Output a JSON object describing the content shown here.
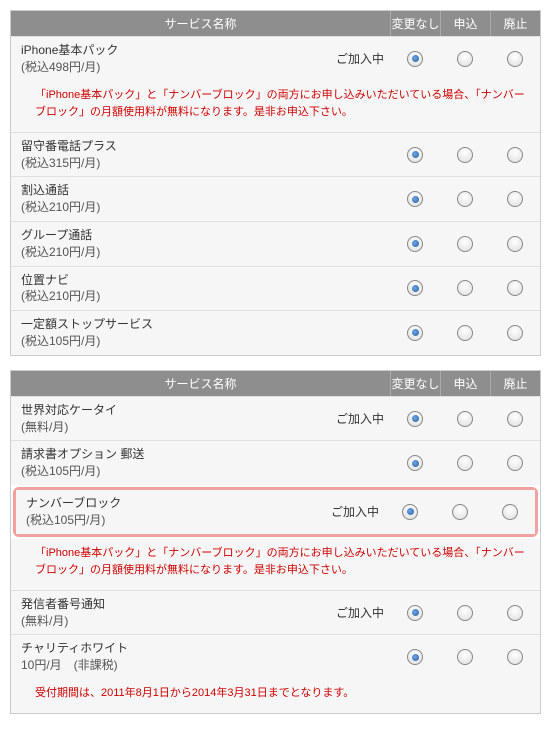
{
  "headers": {
    "service_name": "サービス名称",
    "no_change": "変更なし",
    "apply": "申込",
    "cancel": "廃止"
  },
  "status_label": "ご加入中",
  "section1": {
    "items": [
      {
        "name": "iPhone基本パック",
        "price": "(税込498円/月)",
        "status": true,
        "selected": 0
      },
      {
        "name": "留守番電話プラス",
        "price": "(税込315円/月)",
        "status": false,
        "selected": 0
      },
      {
        "name": "割込通話",
        "price": "(税込210円/月)",
        "status": false,
        "selected": 0
      },
      {
        "name": "グループ通話",
        "price": "(税込210円/月)",
        "status": false,
        "selected": 0
      },
      {
        "name": "位置ナビ",
        "price": "(税込210円/月)",
        "status": false,
        "selected": 0
      },
      {
        "name": "一定額ストップサービス",
        "price": "(税込105円/月)",
        "status": false,
        "selected": 0
      }
    ],
    "notice": "「iPhone基本パック」と「ナンバーブロック」の両方にお申し込みいただいている場合、「ナンバーブロック」の月額使用料が無料になります。是非お申込下さい。"
  },
  "section2": {
    "items": [
      {
        "name": "世界対応ケータイ",
        "price": "(無料/月)",
        "status": true,
        "selected": 0,
        "highlight": false
      },
      {
        "name": "請求書オプション 郵送",
        "price": "(税込105円/月)",
        "status": false,
        "selected": 0,
        "highlight": false
      },
      {
        "name": "ナンバーブロック",
        "price": "(税込105円/月)",
        "status": true,
        "selected": 0,
        "highlight": true
      },
      {
        "name": "発信者番号通知",
        "price": "(無料/月)",
        "status": true,
        "selected": 0,
        "highlight": false
      },
      {
        "name": "チャリティホワイト",
        "price": "10円/月　(非課税)",
        "status": false,
        "selected": 0,
        "highlight": false
      }
    ],
    "notice1": "「iPhone基本パック」と「ナンバーブロック」の両方にお申し込みいただいている場合、「ナンバーブロック」の月額使用料が無料になります。是非お申込下さい。",
    "notice2": "受付期間は、2011年8月1日から2014年3月31日までとなります。"
  }
}
